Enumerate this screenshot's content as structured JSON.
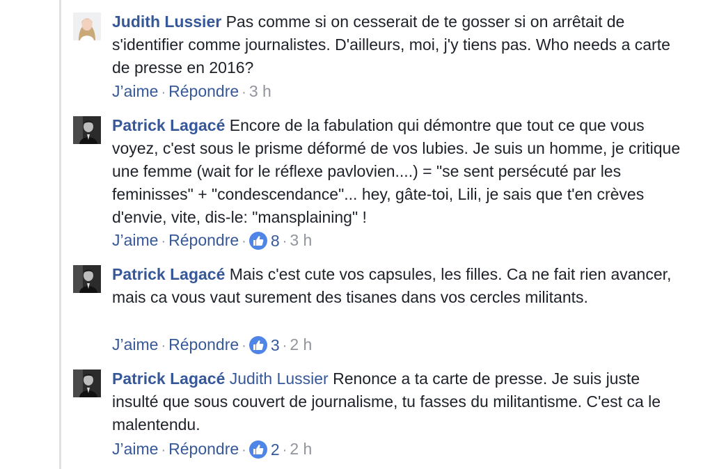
{
  "comments": [
    {
      "author": "Judith Lussier",
      "mention": "",
      "text": "Pas comme si on cesserait de te gosser si on arrêtait de s'identifier comme journalistes. D'ailleurs, moi, j'y tiens pas. Who needs a carte de presse en 2016?",
      "like_label": "J’aime",
      "reply_label": "Répondre",
      "reactions": "",
      "time": "3 h"
    },
    {
      "author": "Patrick Lagacé",
      "mention": "",
      "text": "Encore de la fabulation qui démontre que tout ce que vous voyez, c'est sous le prisme déformé de vos lubies. Je suis un homme, je critique une femme (wait for le réflexe pavlovien....) = \"se sent persécuté par les feminisses\" + \"condescendance\"... hey, gâte-toi, Lili, je sais que t'en crèves d'envie, vite, dis-le: \"mansplaining\" !",
      "like_label": "J’aime",
      "reply_label": "Répondre",
      "reactions": "8",
      "time": "3 h"
    },
    {
      "author": "Patrick Lagacé",
      "mention": "",
      "text": "Mais c'est cute vos capsules, les filles. Ca ne fait rien avancer, mais ca vous vaut surement des tisanes dans vos cercles militants.",
      "like_label": "J’aime",
      "reply_label": "Répondre",
      "reactions": "3",
      "time": "2 h"
    },
    {
      "author": "Patrick Lagacé",
      "mention": "Judith Lussier",
      "text": "Renonce a ta carte de presse. Je suis juste insulté que sous couvert de journalisme, tu fasses du militantisme. C'est ca le malentendu.",
      "like_label": "J’aime",
      "reply_label": "Répondre",
      "reactions": "2",
      "time": "2 h"
    }
  ],
  "colors": {
    "link": "#365899",
    "text": "#1d2129",
    "meta": "#90949c",
    "like_badge": "#4f85e6",
    "thread_line": "#dfe1e6"
  },
  "icons": {
    "reaction": "thumbs-up-icon"
  }
}
